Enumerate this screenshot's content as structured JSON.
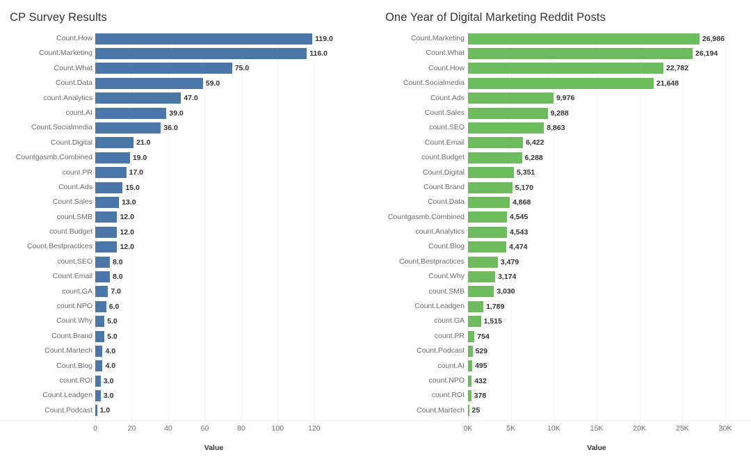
{
  "chart_data": [
    {
      "type": "bar",
      "orientation": "horizontal",
      "title": "CP Survey Results",
      "xlabel": "Value",
      "ylabel": "",
      "xlim": [
        0,
        130
      ],
      "grid": true,
      "legend": "none",
      "bar_color": "#4a76a8",
      "xticks": [
        {
          "label": "0",
          "value": 0
        },
        {
          "label": "20",
          "value": 20
        },
        {
          "label": "40",
          "value": 40
        },
        {
          "label": "60",
          "value": 60
        },
        {
          "label": "80",
          "value": 80
        },
        {
          "label": "100",
          "value": 100
        },
        {
          "label": "120",
          "value": 120
        }
      ],
      "categories": [
        "Count.How",
        "Count.Marketing",
        "Count.What",
        "Count.Data",
        "count.Analytics",
        "count.AI",
        "Count.Socialmedia",
        "Count.Digital",
        "Countgasmb.Combined",
        "count.PR",
        "Count.Ads",
        "Count.Sales",
        "count.SMB",
        "count.Budget",
        "Count.Bestpractices",
        "count.SEO",
        "Count.Email",
        "count.GA",
        "count.NPO",
        "Count.Why",
        "Count.Brand",
        "Count.Martech",
        "Count.Blog",
        "count.ROI",
        "Count.Leadgen",
        "Count.Podcast"
      ],
      "values": [
        119,
        116,
        75,
        59,
        47,
        39,
        36,
        21,
        19,
        17,
        15,
        13,
        12,
        12,
        12,
        8,
        8,
        7,
        6,
        5,
        5,
        4,
        4,
        3,
        3,
        1
      ],
      "value_labels": [
        "119.0",
        "116.0",
        "75.0",
        "59.0",
        "47.0",
        "39.0",
        "36.0",
        "21.0",
        "19.0",
        "17.0",
        "15.0",
        "13.0",
        "12.0",
        "12.0",
        "12.0",
        "8.0",
        "8.0",
        "7.0",
        "6.0",
        "5.0",
        "5.0",
        "4.0",
        "4.0",
        "3.0",
        "3.0",
        "1.0"
      ]
    },
    {
      "type": "bar",
      "orientation": "horizontal",
      "title": "One Year of Digital Marketing Reddit Posts",
      "xlabel": "Value",
      "ylabel": "",
      "xlim": [
        0,
        30000
      ],
      "grid": true,
      "legend": "none",
      "bar_color": "#6dba5f",
      "xticks": [
        {
          "label": "0K",
          "value": 0
        },
        {
          "label": "5K",
          "value": 5000
        },
        {
          "label": "10K",
          "value": 10000
        },
        {
          "label": "15K",
          "value": 15000
        },
        {
          "label": "20K",
          "value": 20000
        },
        {
          "label": "25K",
          "value": 25000
        },
        {
          "label": "30K",
          "value": 30000
        }
      ],
      "categories": [
        "Count.Marketing",
        "Count.What",
        "Count.How",
        "Count.Socialmedia",
        "Count.Ads",
        "Count.Sales",
        "count.SEO",
        "Count.Email",
        "count.Budget",
        "Count.Digital",
        "Count.Brand",
        "Count.Data",
        "Countgasmb.Combined",
        "count.Analytics",
        "Count.Blog",
        "Count.Bestpractices",
        "Count.Why",
        "count.SMB",
        "Count.Leadgen",
        "count.GA",
        "count.PR",
        "Count.Podcast",
        "count.AI",
        "count.NPO",
        "count.ROI",
        "Count.Martech"
      ],
      "values": [
        26986,
        26194,
        22782,
        21648,
        9976,
        9288,
        8863,
        6422,
        6288,
        5351,
        5170,
        4868,
        4545,
        4543,
        4474,
        3479,
        3174,
        3030,
        1789,
        1515,
        754,
        529,
        495,
        432,
        378,
        25
      ],
      "value_labels": [
        "26,986",
        "26,194",
        "22,782",
        "21,648",
        "9,976",
        "9,288",
        "8,863",
        "6,422",
        "6,288",
        "5,351",
        "5,170",
        "4,868",
        "4,545",
        "4,543",
        "4,474",
        "3,479",
        "3,174",
        "3,030",
        "1,789",
        "1,515",
        "754",
        "529",
        "495",
        "432",
        "378",
        "25"
      ]
    }
  ],
  "left_chart": {
    "title": "CP Survey Results",
    "axis_title": "Value"
  },
  "right_chart": {
    "title": "One Year of Digital Marketing Reddit Posts",
    "axis_title": "Value"
  }
}
